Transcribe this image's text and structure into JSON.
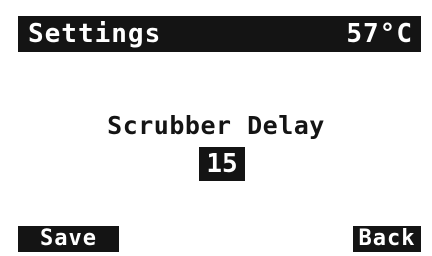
{
  "header": {
    "title": "Settings",
    "temperature": "57°C"
  },
  "setting": {
    "name": "Scrubber Delay",
    "value": "15"
  },
  "softkeys": {
    "left_label": "Save",
    "right_label": "Back"
  },
  "colors": {
    "background": "#ffffff",
    "foreground": "#141414",
    "inverse_text": "#ffffff"
  }
}
